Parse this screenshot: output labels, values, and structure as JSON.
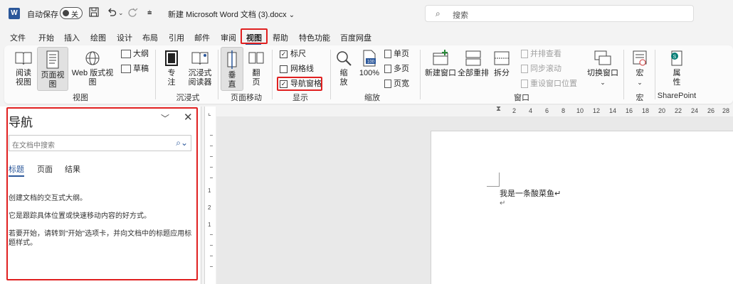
{
  "title_bar": {
    "logo": "W",
    "autosave_label": "自动保存",
    "autosave_state": "关",
    "save_icon": "save-icon",
    "undo_icon": "undo-icon",
    "redo_icon": "redo-icon",
    "customize_icon": "customize-qa-icon",
    "document_title": "新建 Microsoft Word 文档 (3).docx",
    "document_title_chevron": "⌄",
    "search_placeholder": "搜索"
  },
  "menu": {
    "items": [
      "文件",
      "开始",
      "插入",
      "绘图",
      "设计",
      "布局",
      "引用",
      "邮件",
      "审阅",
      "视图",
      "帮助",
      "特色功能",
      "百度网盘"
    ],
    "active": "视图"
  },
  "ribbon": {
    "views": {
      "read_mode": "阅读\n视图",
      "print_layout": "页面视图",
      "web_layout": "Web 版式视图",
      "outline": "大纲",
      "draft": "草稿",
      "group_label": "视图"
    },
    "immersive": {
      "focus": "专\n注",
      "immersive_reader": "沉浸式\n阅读器",
      "group_label": "沉浸式"
    },
    "page_movement": {
      "vertical": "垂\n直",
      "side_to_side": "翻\n页",
      "group_label": "页面移动"
    },
    "show": {
      "ruler": "标尺",
      "gridlines": "网格线",
      "nav_pane": "导航窗格",
      "ruler_checked": true,
      "gridlines_checked": false,
      "nav_pane_checked": true,
      "group_label": "显示"
    },
    "zoom": {
      "zoom": "缩\n放",
      "hundred": "100%",
      "hundred_icon_text": "100",
      "one_page": "单页",
      "multiple_pages": "多页",
      "page_width": "页宽",
      "group_label": "缩放"
    },
    "window": {
      "new_window": "新建窗口",
      "arrange_all": "全部重排",
      "split": "拆分",
      "view_side_by_side": "并排查看",
      "sync_scrolling": "同步滚动",
      "reset_window": "重设窗口位置",
      "switch_windows": "切换窗口",
      "group_label": "窗口"
    },
    "macros": {
      "macros": "宏",
      "group_label": "宏"
    },
    "sharepoint": {
      "properties": "属\n性",
      "group_label": "SharePoint"
    }
  },
  "nav_pane": {
    "title": "导航",
    "search_placeholder": "在文档中搜索",
    "tabs": [
      "标题",
      "页面",
      "结果"
    ],
    "active_tab": "标题",
    "lines": [
      "创建文档的交互式大纲。",
      "它是跟踪具体位置或快速移动内容的好方式。",
      "若要开始，请转到\"开始\"选项卡，并向文档中的标题应用标题样式。"
    ]
  },
  "ruler": {
    "numbers": [
      "2",
      "4",
      "6",
      "8",
      "10",
      "12",
      "14",
      "16",
      "18",
      "20",
      "22",
      "24",
      "26",
      "28"
    ],
    "vertical_numbers": [
      "1",
      "2",
      "1"
    ]
  },
  "document": {
    "line1": "我是一条酸菜鱼↵",
    "line2": "↵"
  },
  "colors": {
    "accent": "#2b579a",
    "highlight_box": "#e02020"
  }
}
